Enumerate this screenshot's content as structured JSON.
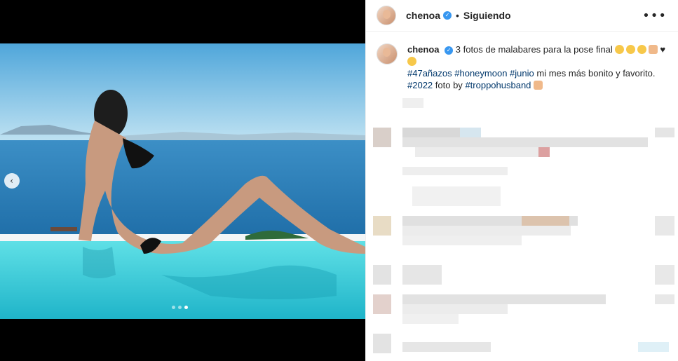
{
  "post": {
    "username": "chenoa",
    "follow_status": "Siguiendo",
    "more_icon": "more-options-icon",
    "caption_text": "3 fotos de malabares para la pose final",
    "caption_line2_suffix": "mi mes más bonito y favorito.",
    "hashtags": [
      "#47añazos",
      "#honeymoon",
      "#junio",
      "#2022"
    ],
    "photo_by_text": "foto by",
    "photo_by_handle": "#troppohusband",
    "separator": "•"
  },
  "carousel": {
    "prev_icon": "chevron-left-icon",
    "slide_count": 3,
    "active_slide": 3
  },
  "colors": {
    "link": "#00376b",
    "verified": "#3897f0",
    "sky": "#7fc3e8",
    "sea": "#2a7fb8",
    "pool": "#38c9d6"
  }
}
